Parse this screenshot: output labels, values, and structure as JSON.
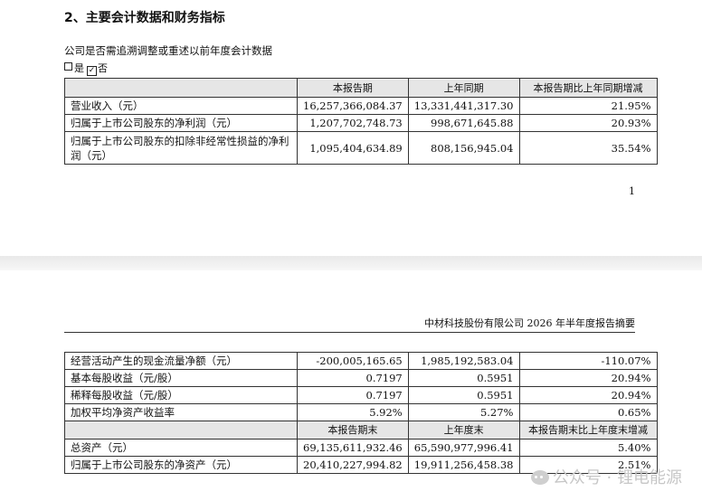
{
  "section_title": "2、主要会计数据和财务指标",
  "question": "公司是否需追溯调整或重述以前年度会计数据",
  "checkbox_yes": "是",
  "checkbox_no": "否",
  "page_number": "1",
  "page2_header": "中材科技股份有限公司 2026 年半年度报告摘要",
  "table1": {
    "headers": [
      "",
      "本报告期",
      "上年同期",
      "本报告期比上年同期增减"
    ],
    "rows": [
      [
        "营业收入（元）",
        "16,257,366,084.37",
        "13,331,441,317.30",
        "21.95%"
      ],
      [
        "归属于上市公司股东的净利润（元）",
        "1,207,702,748.73",
        "998,671,645.88",
        "20.93%"
      ],
      [
        "归属于上市公司股东的扣除非经常性损益的净利润（元）",
        "1,095,404,634.89",
        "808,156,945.04",
        "35.54%"
      ]
    ]
  },
  "table2": {
    "rows": [
      [
        "经营活动产生的现金流量净额（元）",
        "-200,005,165.65",
        "1,985,192,583.04",
        "-110.07%"
      ],
      [
        "基本每股收益（元/股）",
        "0.7197",
        "0.5951",
        "20.94%"
      ],
      [
        "稀释每股收益（元/股）",
        "0.7197",
        "0.5951",
        "20.94%"
      ],
      [
        "加权平均净资产收益率",
        "5.92%",
        "5.27%",
        "0.65%"
      ]
    ],
    "subheaders": [
      "",
      "本报告期末",
      "上年度末",
      "本报告期末比上年度末增减"
    ],
    "rows2": [
      [
        "总资产（元）",
        "69,135,611,932.46",
        "65,590,977,996.41",
        "5.40%"
      ],
      [
        "归属于上市公司股东的净资产（元）",
        "20,410,227,994.82",
        "19,911,256,458.38",
        "2.51%"
      ]
    ]
  },
  "watermark": "公众号 · 锂电能源"
}
